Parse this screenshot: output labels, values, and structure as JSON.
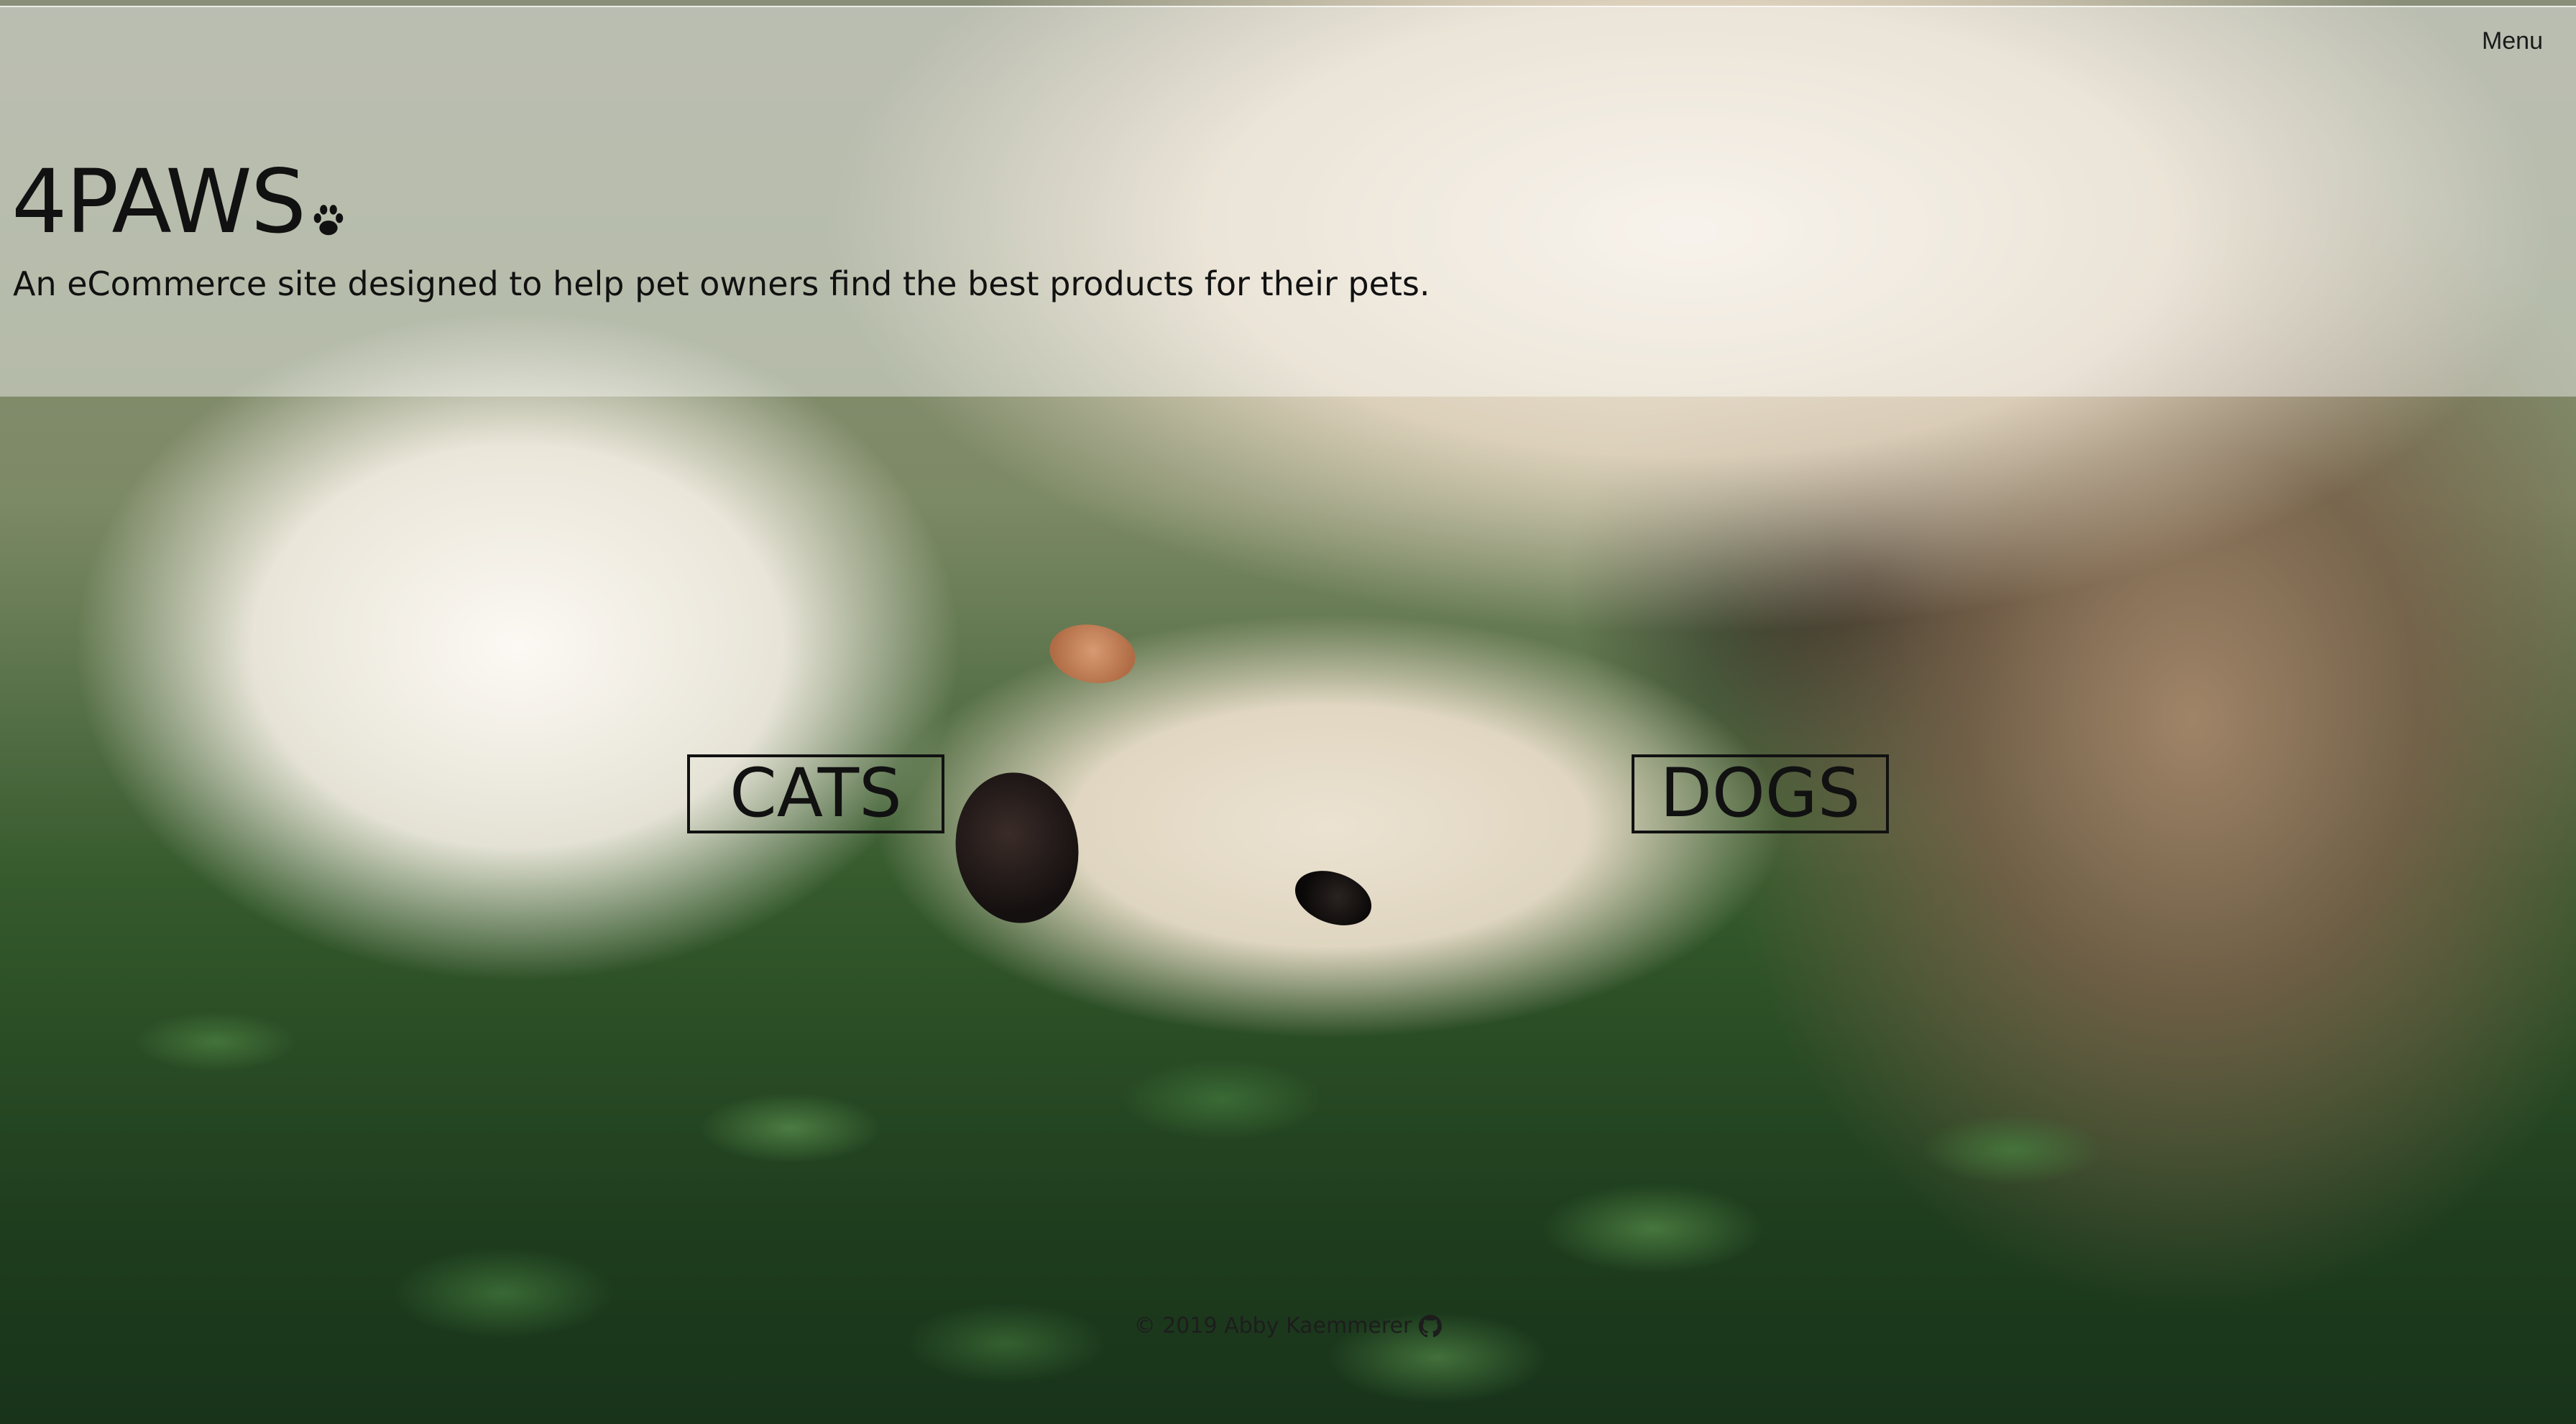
{
  "header": {
    "menu_label": "Menu",
    "brand_title": "4PAWS",
    "brand_icon": "paw-icon",
    "tagline": "An eCommerce site designed to help pet owners find the best products for their pets."
  },
  "main": {
    "buttons": [
      {
        "label": "CATS"
      },
      {
        "label": "DOGS"
      }
    ]
  },
  "footer": {
    "copyright": "© 2019 Abby Kaemmerer",
    "icon": "github-icon"
  },
  "colors": {
    "text": "#111111",
    "header_overlay": "rgba(255,255,255,0.42)"
  }
}
